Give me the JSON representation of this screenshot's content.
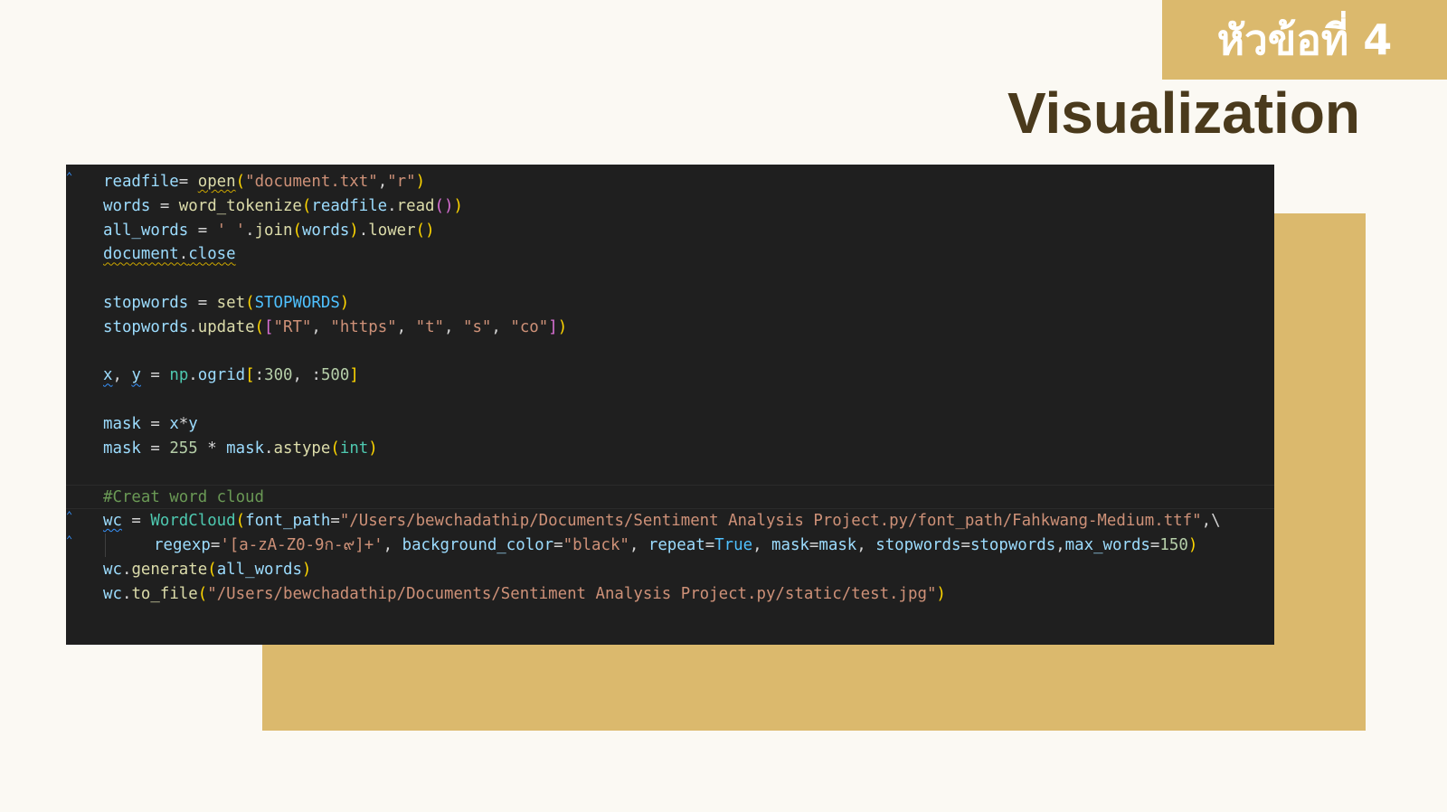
{
  "slide": {
    "badge": "หัวข้อที่ 4",
    "title": "Visualization"
  },
  "code": {
    "language": "python",
    "lines": [
      "readfile= open(\"document.txt\",\"r\")",
      "words = word_tokenize(readfile.read())",
      "all_words = ' '.join(words).lower()",
      "document.close",
      "",
      "stopwords = set(STOPWORDS)",
      "stopwords.update([\"RT\", \"https\", \"t\", \"s\", \"co\"])",
      "",
      "x, y = np.ogrid[:300, :500]",
      "",
      "mask = x*y",
      "mask = 255 * mask.astype(int)",
      "",
      "#Creat word cloud",
      "wc = WordCloud(font_path=\"/Users/bewchadathip/Documents/Sentiment Analysis Project.py/font_path/Fahkwang-Medium.ttf\",\\",
      "    regexp='[a-zA-Z0-9ก-๙]+', background_color=\"black\", repeat=True, mask=mask, stopwords=stopwords,max_words=150)",
      "wc.generate(all_words)",
      "wc.to_file(\"/Users/bewchadathip/Documents/Sentiment Analysis Project.py/static/test.jpg\")"
    ]
  },
  "colors": {
    "background": "#fbf9f3",
    "accent_gold": "#dbb96d",
    "title_brown": "#4a3a1c",
    "editor_bg": "#1f1f1f"
  },
  "icons": {
    "fold_marker": "fold-caret-icon"
  }
}
